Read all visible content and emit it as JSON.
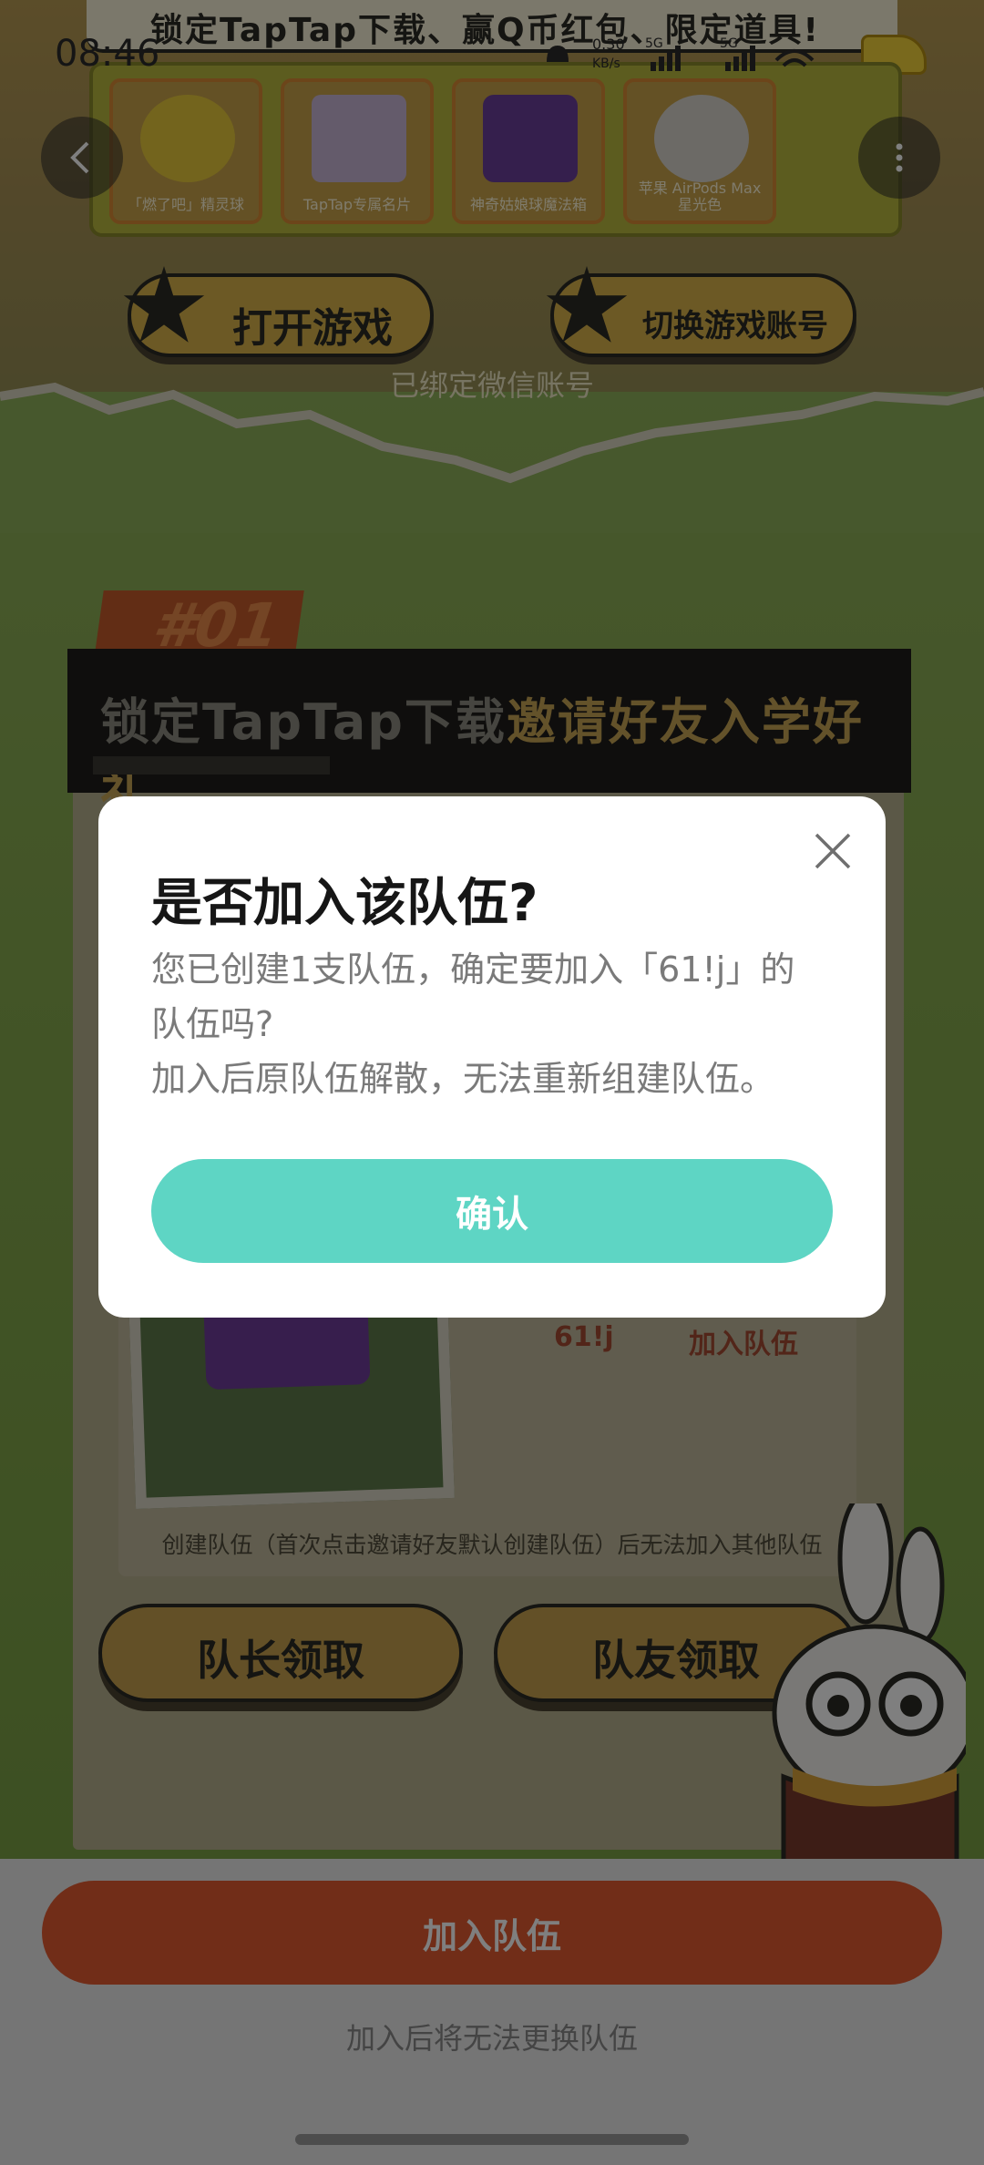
{
  "status_bar": {
    "time": "08:46",
    "net_speed_value": "0.30",
    "net_speed_unit": "KB/s",
    "network_1": "5G",
    "network_2": "5G"
  },
  "banner": {
    "text": "锁定TapTap下载、赢Q币红包、限定道具!"
  },
  "prizes": [
    {
      "caption": "「燃了吧」精灵球"
    },
    {
      "caption": "TapTap专属名片"
    },
    {
      "caption": "神奇姑娘球魔法箱"
    },
    {
      "caption": "苹果 AirPods Max 星光色"
    }
  ],
  "actions": {
    "open_game": "打开游戏",
    "switch_account": "切换游戏账号",
    "bound_status": "已绑定微信账号"
  },
  "section": {
    "badge": "#01",
    "title_prefix": "锁定TapTap下载",
    "title_highlight": "邀请好友入学好礼"
  },
  "team": {
    "member_name": "61!j",
    "join_label": "加入队伍",
    "rule_note": "创建队伍（首次点击邀请好友默认创建队伍）后无法加入其他队伍"
  },
  "claim": {
    "captain": "队长领取",
    "teammate": "队友领取"
  },
  "bottom": {
    "join_button": "加入队伍",
    "note": "加入后将无法更换队伍"
  },
  "dialog": {
    "title": "是否加入该队伍?",
    "line1": "您已创建1支队伍，确定要加入「61!j」的",
    "line2": "队伍吗?",
    "line3": "加入后原队伍解散，无法重新组建队伍。",
    "confirm": "确认"
  },
  "colors": {
    "confirm": "#5ed5c4",
    "join": "#e35a31",
    "title": "#161616",
    "body_text": "#7a7a7a"
  }
}
